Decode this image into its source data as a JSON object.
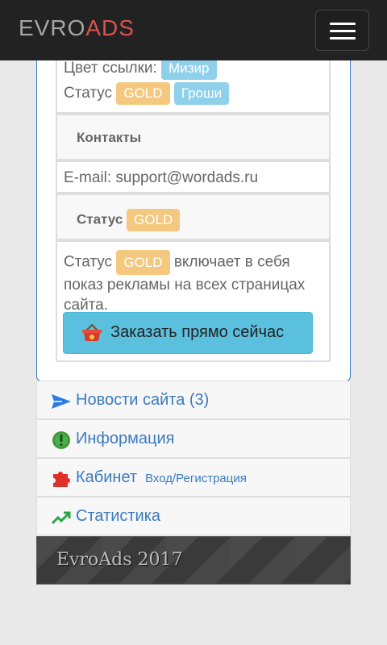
{
  "navbar": {
    "brand_part1": "EVRO",
    "brand_part2": "ADS"
  },
  "details": {
    "link_color_label": "Цвет ссылки:",
    "link_color_value": "Мизир",
    "status_label": "Статус",
    "status_gold": "GOLD",
    "status_groshi": "Гроши"
  },
  "contacts": {
    "heading": "Контакты",
    "email_text": "E-mail: support@wordads.ru"
  },
  "status_section": {
    "heading": "Статус",
    "badge": "GOLD",
    "desc_prefix": "Статус",
    "desc_badge": "GOLD",
    "desc_suffix_line1": "включает в себя",
    "desc_line2": "показ рекламы на всех страницах",
    "desc_line3": "сайта.",
    "order_button": "Заказать прямо сейчас"
  },
  "menu": [
    {
      "label": "Новости сайта (3)",
      "icon": "send-icon"
    },
    {
      "label": "Информация",
      "icon": "info-badge-icon"
    },
    {
      "label": "Кабинет",
      "sub": "Вход/Регистрация",
      "icon": "puzzle-icon"
    },
    {
      "label": "Статистика",
      "icon": "trending-up-icon"
    }
  ],
  "footer": {
    "text": "EvroAds 2017"
  },
  "colors": {
    "navbar": "#222222",
    "brand_accent": "#d9534f",
    "link": "#3a7bbf",
    "gold": "#f5c87f",
    "info": "#5bc0de"
  }
}
